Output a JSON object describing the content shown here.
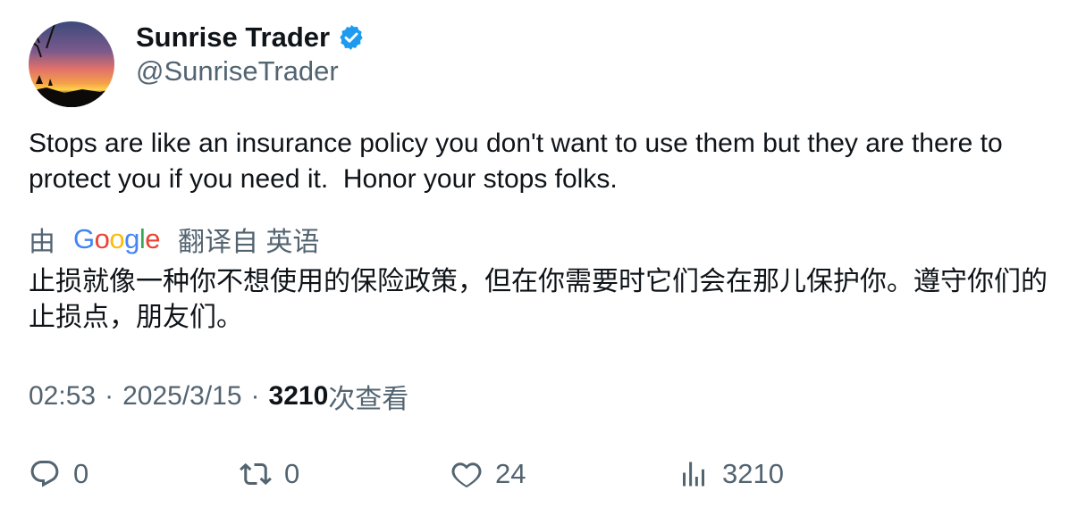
{
  "author": {
    "display_name": "Sunrise Trader",
    "handle": "@SunriseTrader",
    "verified_icon": "verified-badge-icon",
    "avatar_icon": "sunset-avatar"
  },
  "tweet": {
    "text": "Stops are like an insurance policy you don't want to use them but they are there to protect you if you need it.  Honor your stops folks."
  },
  "translation": {
    "prefix": "由",
    "provider": "Google",
    "suffix": "翻译自 英语",
    "text": "止损就像一种你不想使用的保险政策，但在你需要时它们会在那儿保护你。遵守你们的止损点，朋友们。"
  },
  "meta": {
    "time": "02:53",
    "separator": "·",
    "date": "2025/3/15",
    "views_count": "3210",
    "views_label": "次查看"
  },
  "actions": {
    "reply_count": "0",
    "retweet_count": "0",
    "like_count": "24",
    "views_count": "3210"
  },
  "colors": {
    "text_primary": "#0f1419",
    "text_secondary": "#536471",
    "verified_blue": "#1d9bf0"
  }
}
